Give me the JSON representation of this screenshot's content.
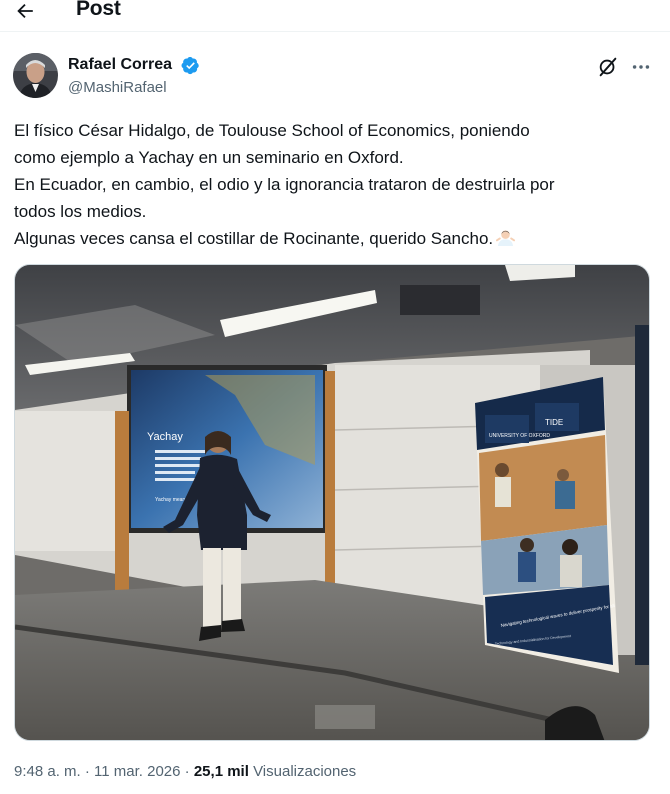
{
  "header": {
    "title": "Post",
    "back_icon": "arrow-left-icon"
  },
  "author": {
    "name": "Rafael Correa",
    "handle": "@MashiRafael",
    "verified_color": "#1d9bf0",
    "avatar_icon": "avatar"
  },
  "actions": {
    "grok_icon": "grok-icon",
    "more_icon": "more-icon"
  },
  "tweet": {
    "lines": [
      "El físico César Hidalgo, de Toulouse School of Economics, poniendo",
      "como ejemplo a Yachay en un seminario en Oxford.",
      "En Ecuador, en cambio, el odio y la ignorancia trataron de destruirla por",
      "todos los medios.",
      "Algunas veces cansa el costillar de Rocinante, querido Sancho."
    ],
    "emoji": "man-shrugging-emoji"
  },
  "media": {
    "slide_title": "Yachay",
    "slide_caption": "Yachay means...",
    "banner_logo_1": "UNIVERSITY OF OXFORD",
    "banner_logo_2": "TIDE",
    "banner_text_1": "Navigating technological waves to deliver prosperity for all",
    "banner_text_2": "Technology and Industrialisation for Development"
  },
  "meta": {
    "time": "9:48 a. m.",
    "separator": "·",
    "date": "11 mar. 2026",
    "views": "25,1 mil",
    "views_label": "Visualizaciones"
  },
  "colors": {
    "text_primary": "#0f1419",
    "text_secondary": "#536471",
    "accent": "#1d9bf0"
  }
}
